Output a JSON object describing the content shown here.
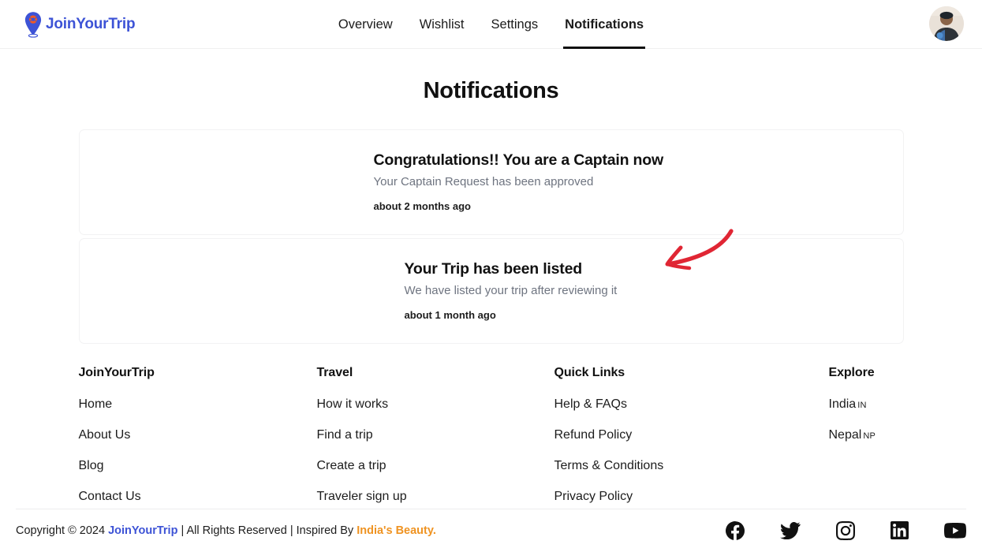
{
  "header": {
    "brand": {
      "name": "JoinYourTrip",
      "pin_icon": "map-pin-icon",
      "pin_color": "#3d53d6",
      "pin_accent_color": "#ef5a24"
    },
    "nav": [
      {
        "label": "Overview",
        "active": false
      },
      {
        "label": "Wishlist",
        "active": false
      },
      {
        "label": "Settings",
        "active": false
      },
      {
        "label": "Notifications",
        "active": true
      }
    ],
    "avatar": {
      "icon": "user-avatar-photo"
    }
  },
  "main": {
    "title": "Notifications",
    "notifications": [
      {
        "title": "Congratulations!! You are a Captain now",
        "subtitle": "Your Captain Request has been approved",
        "time": "about 2 months ago"
      },
      {
        "title": "Your Trip has been listed",
        "subtitle": "We have listed your trip after reviewing it",
        "time": "about 1 month ago"
      }
    ],
    "annotation": {
      "icon": "red-curved-arrow-icon",
      "color": "#e02634",
      "points_to": "Your Trip has been listed"
    }
  },
  "footer": {
    "columns": [
      {
        "title": "JoinYourTrip",
        "links": [
          "Home",
          "About Us",
          "Blog",
          "Contact Us"
        ]
      },
      {
        "title": "Travel",
        "links": [
          "How it works",
          "Find a trip",
          "Create a trip",
          "Traveler sign up"
        ]
      },
      {
        "title": "Quick Links",
        "links": [
          "Help & FAQs",
          "Refund Policy",
          "Terms & Conditions",
          "Privacy Policy"
        ]
      },
      {
        "title": "Explore",
        "countries": [
          {
            "name": "India",
            "code": "IN"
          },
          {
            "name": "Nepal",
            "code": "NP"
          }
        ]
      }
    ],
    "copyright": {
      "prefix": "Copyright © 2024 ",
      "brand": "JoinYourTrip",
      "middle": " | All Rights Reserved | Inspired By ",
      "inspired": "India's Beauty.",
      "brand_color": "#3d53d6",
      "inspired_color": "#ef9322"
    },
    "socials": [
      {
        "name": "facebook-icon",
        "label": "Facebook"
      },
      {
        "name": "twitter-icon",
        "label": "Twitter"
      },
      {
        "name": "instagram-icon",
        "label": "Instagram"
      },
      {
        "name": "linkedin-icon",
        "label": "LinkedIn"
      },
      {
        "name": "youtube-icon",
        "label": "YouTube"
      }
    ]
  }
}
